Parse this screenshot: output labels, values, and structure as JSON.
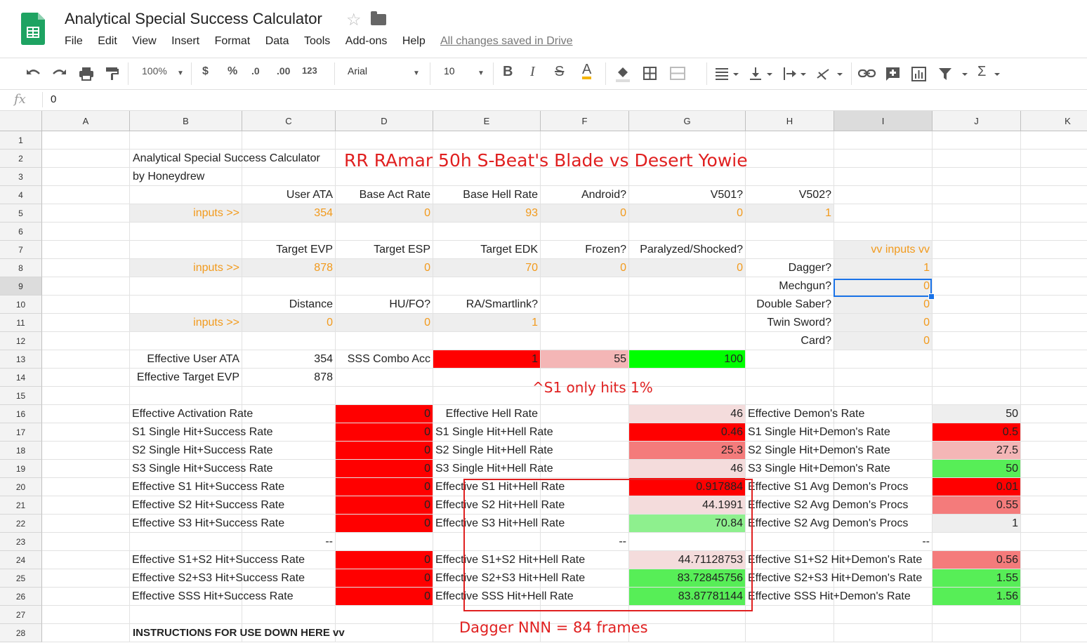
{
  "app": {
    "title": "Analytical Special Success Calculator",
    "star_glyph": "☆",
    "saved_status": "All changes saved in Drive",
    "menu": [
      "File",
      "Edit",
      "View",
      "Insert",
      "Format",
      "Data",
      "Tools",
      "Add-ons",
      "Help"
    ]
  },
  "toolbar": {
    "zoom": "100%",
    "currency": "$",
    "percent": "%",
    "dec_less": ".0",
    "dec_more": ".00",
    "format_more": "123",
    "font": "Arial",
    "font_size": "10",
    "bold": "B",
    "italic": "I",
    "strike": "S",
    "text_color": "A",
    "sigma": "Σ",
    "icons": [
      "undo-icon",
      "redo-icon",
      "print-icon",
      "paint-format-icon",
      "fill-color-icon",
      "borders-icon",
      "merge-cells-icon",
      "align-icon",
      "valign-icon",
      "text-wrap-icon",
      "text-rotate-icon",
      "link-icon",
      "comment-icon",
      "chart-icon",
      "filter-icon",
      "functions-icon"
    ]
  },
  "formula_bar": {
    "fx_label": "fx",
    "value": "0"
  },
  "selected_cell": "I9",
  "columns": [
    "A",
    "B",
    "C",
    "D",
    "E",
    "F",
    "G",
    "H",
    "I",
    "J",
    "K"
  ],
  "rows": [
    "1",
    "2",
    "3",
    "4",
    "5",
    "6",
    "7",
    "8",
    "9",
    "10",
    "11",
    "12",
    "13",
    "14",
    "15",
    "16",
    "17",
    "18",
    "19",
    "20",
    "21",
    "22",
    "23",
    "24",
    "25",
    "26",
    "27",
    "28"
  ],
  "colors": {
    "red": "#ff0000",
    "light_red": "#f4b6b6",
    "salmon": "#f47b7b",
    "pale_red": "#f4dcdc",
    "green": "#00ff00",
    "green2": "#57ee57",
    "light_green": "#8ef08e",
    "grey": "#eeeeee",
    "orange_text": "#f29a1c",
    "annotation_red": "#e02020"
  },
  "cells": [
    {
      "ref": "B2",
      "v": "Analytical Special Success Calculator",
      "align": "l"
    },
    {
      "ref": "B3",
      "v": "by Honeydrew",
      "align": "l"
    },
    {
      "ref": "C4",
      "v": "User ATA"
    },
    {
      "ref": "D4",
      "v": "Base Act Rate"
    },
    {
      "ref": "E4",
      "v": "Base Hell Rate"
    },
    {
      "ref": "F4",
      "v": "Android?"
    },
    {
      "ref": "G4",
      "v": "V501?"
    },
    {
      "ref": "H4",
      "v": "V502?"
    },
    {
      "ref": "B5",
      "v": "inputs >>",
      "bg": "grey",
      "color": "orange_text"
    },
    {
      "ref": "C5",
      "v": "354",
      "bg": "grey",
      "color": "orange_text"
    },
    {
      "ref": "D5",
      "v": "0",
      "bg": "grey",
      "color": "orange_text"
    },
    {
      "ref": "E5",
      "v": "93",
      "bg": "grey",
      "color": "orange_text"
    },
    {
      "ref": "F5",
      "v": "0",
      "bg": "grey",
      "color": "orange_text"
    },
    {
      "ref": "G5",
      "v": "0",
      "bg": "grey",
      "color": "orange_text"
    },
    {
      "ref": "H5",
      "v": "1",
      "bg": "grey",
      "color": "orange_text"
    },
    {
      "ref": "C7",
      "v": "Target EVP"
    },
    {
      "ref": "D7",
      "v": "Target ESP"
    },
    {
      "ref": "E7",
      "v": "Target EDK"
    },
    {
      "ref": "F7",
      "v": "Frozen?"
    },
    {
      "ref": "G7",
      "v": "Paralyzed/Shocked?"
    },
    {
      "ref": "I7",
      "v": "vv inputs vv",
      "bg": "grey",
      "color": "orange_text"
    },
    {
      "ref": "B8",
      "v": "inputs >>",
      "bg": "grey",
      "color": "orange_text"
    },
    {
      "ref": "C8",
      "v": "878",
      "bg": "grey",
      "color": "orange_text"
    },
    {
      "ref": "D8",
      "v": "0",
      "bg": "grey",
      "color": "orange_text"
    },
    {
      "ref": "E8",
      "v": "70",
      "bg": "grey",
      "color": "orange_text"
    },
    {
      "ref": "F8",
      "v": "0",
      "bg": "grey",
      "color": "orange_text"
    },
    {
      "ref": "G8",
      "v": "0",
      "bg": "grey",
      "color": "orange_text"
    },
    {
      "ref": "H8",
      "v": "Dagger?"
    },
    {
      "ref": "I8",
      "v": "1",
      "bg": "grey",
      "color": "orange_text"
    },
    {
      "ref": "H9",
      "v": "Mechgun?"
    },
    {
      "ref": "I9",
      "v": "0",
      "bg": "grey",
      "color": "orange_text"
    },
    {
      "ref": "C10",
      "v": "Distance"
    },
    {
      "ref": "D10",
      "v": "HU/FO?"
    },
    {
      "ref": "E10",
      "v": "RA/Smartlink?"
    },
    {
      "ref": "H10",
      "v": "Double Saber?"
    },
    {
      "ref": "I10",
      "v": "0",
      "bg": "grey",
      "color": "orange_text"
    },
    {
      "ref": "B11",
      "v": "inputs >>",
      "bg": "grey",
      "color": "orange_text"
    },
    {
      "ref": "C11",
      "v": "0",
      "bg": "grey",
      "color": "orange_text"
    },
    {
      "ref": "D11",
      "v": "0",
      "bg": "grey",
      "color": "orange_text"
    },
    {
      "ref": "E11",
      "v": "1",
      "bg": "grey",
      "color": "orange_text"
    },
    {
      "ref": "H11",
      "v": "Twin Sword?"
    },
    {
      "ref": "I11",
      "v": "0",
      "bg": "grey",
      "color": "orange_text"
    },
    {
      "ref": "H12",
      "v": "Card?"
    },
    {
      "ref": "I12",
      "v": "0",
      "bg": "grey",
      "color": "orange_text"
    },
    {
      "ref": "B13",
      "v": "Effective User ATA"
    },
    {
      "ref": "C13",
      "v": "354"
    },
    {
      "ref": "D13",
      "v": "SSS Combo Acc"
    },
    {
      "ref": "E13",
      "v": "1",
      "bg": "red"
    },
    {
      "ref": "F13",
      "v": "55",
      "bg": "light_red"
    },
    {
      "ref": "G13",
      "v": "100",
      "bg": "green"
    },
    {
      "ref": "B14",
      "v": "Effective Target EVP"
    },
    {
      "ref": "C14",
      "v": "878"
    },
    {
      "ref": "B16",
      "v": "Effective Activation Rate"
    },
    {
      "ref": "D16",
      "v": "0",
      "bg": "red"
    },
    {
      "ref": "E16",
      "v": "Effective Hell Rate"
    },
    {
      "ref": "G16",
      "v": "46",
      "bg": "pale_red"
    },
    {
      "ref": "H16",
      "v": "Effective Demon's Rate"
    },
    {
      "ref": "J16",
      "v": "50",
      "bg": "grey"
    },
    {
      "ref": "B17",
      "v": "S1 Single Hit+Success Rate"
    },
    {
      "ref": "D17",
      "v": "0",
      "bg": "red"
    },
    {
      "ref": "E17",
      "v": "S1 Single Hit+Hell Rate"
    },
    {
      "ref": "G17",
      "v": "0.46",
      "bg": "red"
    },
    {
      "ref": "H17",
      "v": "S1 Single Hit+Demon's Rate"
    },
    {
      "ref": "J17",
      "v": "0.5",
      "bg": "red"
    },
    {
      "ref": "B18",
      "v": "S2 Single Hit+Success Rate"
    },
    {
      "ref": "D18",
      "v": "0",
      "bg": "red"
    },
    {
      "ref": "E18",
      "v": "S2 Single Hit+Hell Rate"
    },
    {
      "ref": "G18",
      "v": "25.3",
      "bg": "salmon"
    },
    {
      "ref": "H18",
      "v": "S2 Single Hit+Demon's Rate"
    },
    {
      "ref": "J18",
      "v": "27.5",
      "bg": "light_red"
    },
    {
      "ref": "B19",
      "v": "S3 Single Hit+Success Rate"
    },
    {
      "ref": "D19",
      "v": "0",
      "bg": "red"
    },
    {
      "ref": "E19",
      "v": "S3 Single Hit+Hell Rate"
    },
    {
      "ref": "G19",
      "v": "46",
      "bg": "pale_red"
    },
    {
      "ref": "H19",
      "v": "S3 Single Hit+Demon's Rate"
    },
    {
      "ref": "J19",
      "v": "50",
      "bg": "green2"
    },
    {
      "ref": "B20",
      "v": "Effective S1 Hit+Success Rate"
    },
    {
      "ref": "D20",
      "v": "0",
      "bg": "red"
    },
    {
      "ref": "E20",
      "v": "Effective S1 Hit+Hell Rate"
    },
    {
      "ref": "G20",
      "v": "0.917884",
      "bg": "red"
    },
    {
      "ref": "H20",
      "v": "Effective S1 Avg Demon's Procs"
    },
    {
      "ref": "J20",
      "v": "0.01",
      "bg": "red"
    },
    {
      "ref": "B21",
      "v": "Effective S2 Hit+Success Rate"
    },
    {
      "ref": "D21",
      "v": "0",
      "bg": "red"
    },
    {
      "ref": "E21",
      "v": "Effective S2 Hit+Hell Rate"
    },
    {
      "ref": "G21",
      "v": "44.1991",
      "bg": "pale_red"
    },
    {
      "ref": "H21",
      "v": "Effective S2 Avg Demon's Procs"
    },
    {
      "ref": "J21",
      "v": "0.55",
      "bg": "salmon"
    },
    {
      "ref": "B22",
      "v": "Effective S3 Hit+Success Rate"
    },
    {
      "ref": "D22",
      "v": "0",
      "bg": "red"
    },
    {
      "ref": "E22",
      "v": "Effective S3 Hit+Hell Rate"
    },
    {
      "ref": "G22",
      "v": "70.84",
      "bg": "light_green"
    },
    {
      "ref": "H22",
      "v": "Effective S2 Avg Demon's Procs"
    },
    {
      "ref": "J22",
      "v": "1",
      "bg": "grey"
    },
    {
      "ref": "C23",
      "v": "--"
    },
    {
      "ref": "F23",
      "v": "--"
    },
    {
      "ref": "I23",
      "v": "--"
    },
    {
      "ref": "B24",
      "v": "Effective S1+S2 Hit+Success Rate"
    },
    {
      "ref": "D24",
      "v": "0",
      "bg": "red"
    },
    {
      "ref": "E24",
      "v": "Effective S1+S2 Hit+Hell Rate"
    },
    {
      "ref": "G24",
      "v": "44.71128753",
      "bg": "pale_red"
    },
    {
      "ref": "H24",
      "v": "Effective S1+S2 Hit+Demon's Rate"
    },
    {
      "ref": "J24",
      "v": "0.56",
      "bg": "salmon"
    },
    {
      "ref": "B25",
      "v": "Effective S2+S3 Hit+Success Rate"
    },
    {
      "ref": "D25",
      "v": "0",
      "bg": "red"
    },
    {
      "ref": "E25",
      "v": "Effective S2+S3 Hit+Hell Rate"
    },
    {
      "ref": "G25",
      "v": "83.72845756",
      "bg": "green2"
    },
    {
      "ref": "H25",
      "v": "Effective S2+S3 Hit+Demon's Rate"
    },
    {
      "ref": "J25",
      "v": "1.55",
      "bg": "green2"
    },
    {
      "ref": "B26",
      "v": "Effective SSS Hit+Success Rate"
    },
    {
      "ref": "D26",
      "v": "0",
      "bg": "red"
    },
    {
      "ref": "E26",
      "v": "Effective SSS Hit+Hell Rate"
    },
    {
      "ref": "G26",
      "v": "83.87781144",
      "bg": "green2"
    },
    {
      "ref": "H26",
      "v": "Effective SSS Hit+Demon's Rate"
    },
    {
      "ref": "J26",
      "v": "1.56",
      "bg": "green2"
    },
    {
      "ref": "B28",
      "v": "INSTRUCTIONS FOR USE DOWN HERE vv",
      "align": "l",
      "bold": true
    }
  ],
  "annotations": {
    "title": "RR RAmar 50h S-Beat's Blade vs Desert Yowie",
    "s1_note": "^S1 only hits 1%",
    "frames_note": "Dagger NNN = 84 frames"
  }
}
